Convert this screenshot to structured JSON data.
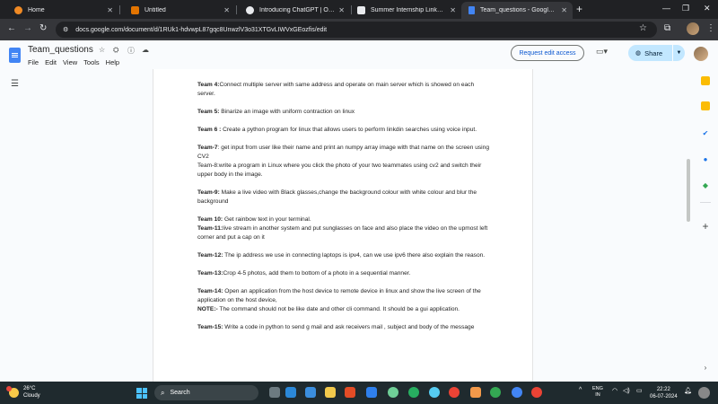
{
  "browser": {
    "tabs": [
      {
        "title": "Home",
        "fav_color": "#f08a24"
      },
      {
        "title": "Untitled",
        "fav_color": "#e37400"
      },
      {
        "title": "Introducing ChatGPT | OpenAI",
        "fav_color": "#e8eaed"
      },
      {
        "title": "Summer Internship LinkedIn Ex",
        "fav_color": "#e8eaed"
      },
      {
        "title": "Team_questions - Google Docs",
        "fav_color": "#4285f4"
      }
    ],
    "active_tab": 4,
    "url": "docs.google.com/document/d/1RUk1-hdvwpL87gqc8UnwzlV3o31XTGvLIWVxGEozfis/edit",
    "icons": [
      "back-icon",
      "forward-icon",
      "reload-icon",
      "site-settings-icon",
      "bookmark-star-icon",
      "extensions-icon",
      "profile-icon",
      "menu-dots-icon"
    ]
  },
  "docs": {
    "title": "Team_questions",
    "menu": [
      "File",
      "Edit",
      "View",
      "Tools",
      "Help"
    ],
    "request_edit_label": "Request edit access",
    "share_label": "Share",
    "brand_color": "#4285f4"
  },
  "document": {
    "paragraphs": [
      {
        "label": "Team 4:",
        "text": "Connect multiple server with same address and operate on main server which is showed on each server."
      },
      {
        "label": "Team 5:",
        "text": " Binarize an image with uniform contraction on linux"
      },
      {
        "label": "Team 6 :",
        "text": " Create a python program for linux that allows users to perform linkdin searches using voice input."
      },
      {
        "label": "Team-7",
        "text": ": get input from user like their name and print an numpy array image with that name on the screen using CV2",
        "join_next": true
      },
      {
        "label": "",
        "text": "Team-8:write a program in Linux where you click the photo of your two teammates using cv2 and switch their upper body in the image."
      },
      {
        "label": "Team-9:",
        "text": " Make a live video with Black glasses,change the background colour with white colour and blur the background"
      },
      {
        "label": "Team 10:",
        "text": " Get rainbow text in your terminal.",
        "join_next": true
      },
      {
        "label": "Team-11:",
        "text": "live stream in another system and put sunglasses on face and also place the video on the upmost left corner and put a cap on it"
      },
      {
        "label": "Team-12:",
        "text": " The ip address we use in connecting laptops is ipv4, can we use ipv6 there also explain the reason."
      },
      {
        "label": "Team-13:",
        "text": "Crop 4-5 photos, add them to bottom of a photo in a sequential manner."
      },
      {
        "label": "Team-14:",
        "text": " Open an application from the host device to remote device in linux and show the live screen of the application on the host device,",
        "join_next": true
      },
      {
        "label": "NOTE:-",
        "text": " The command should not be like date and other cli command. It should be a gui application."
      },
      {
        "label": "Team-15:",
        "text": " Write a code in python to send g mail and  ask receivers mail , subject and body of the message"
      }
    ]
  },
  "taskbar": {
    "weather_temp": "26°C",
    "weather_desc": "Cloudy",
    "search_placeholder": "Search",
    "lang_line1": "ENG",
    "lang_line2": "IN",
    "time": "22:22",
    "date": "06-07-2024"
  }
}
